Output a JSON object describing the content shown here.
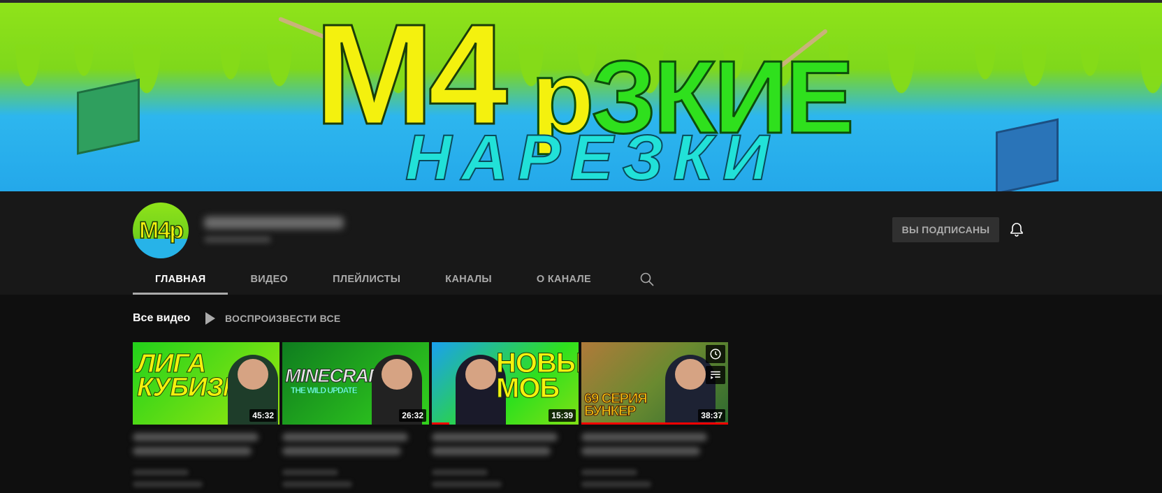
{
  "banner": {
    "title_m4": "M4",
    "title_r": "р",
    "title_rest": "ЗКИЕ",
    "subtitle": "НАРЕЗКИ"
  },
  "channel": {
    "avatar_text": "M4р",
    "subscribe_label": "ВЫ ПОДПИСАНЫ"
  },
  "tabs": [
    {
      "label": "ГЛАВНАЯ",
      "active": true
    },
    {
      "label": "ВИДЕО"
    },
    {
      "label": "ПЛЕЙЛИСТЫ"
    },
    {
      "label": "КАНАЛЫ"
    },
    {
      "label": "О КАНАЛЕ"
    }
  ],
  "shelf": {
    "title": "Все видео",
    "play_all": "ВОСПРОИЗВЕСТИ ВСЕ"
  },
  "videos": [
    {
      "thumb_text": "ЛИГА КУБИЗМА",
      "duration": "45:32"
    },
    {
      "thumb_text": "MINECRAFT",
      "thumb_sub": "THE WILD UPDATE",
      "duration": "26:32"
    },
    {
      "thumb_text": "НОВЫЙ МОБ",
      "duration": "15:39",
      "progress": 0.12
    },
    {
      "thumb_text": "69 СЕРИЯ БУНКЕР",
      "duration": "38:37",
      "progress": 1.0
    }
  ],
  "colors": {
    "accent_yellow": "#f4f10e",
    "accent_green": "#2fe01d",
    "progress_red": "#ff0000"
  }
}
